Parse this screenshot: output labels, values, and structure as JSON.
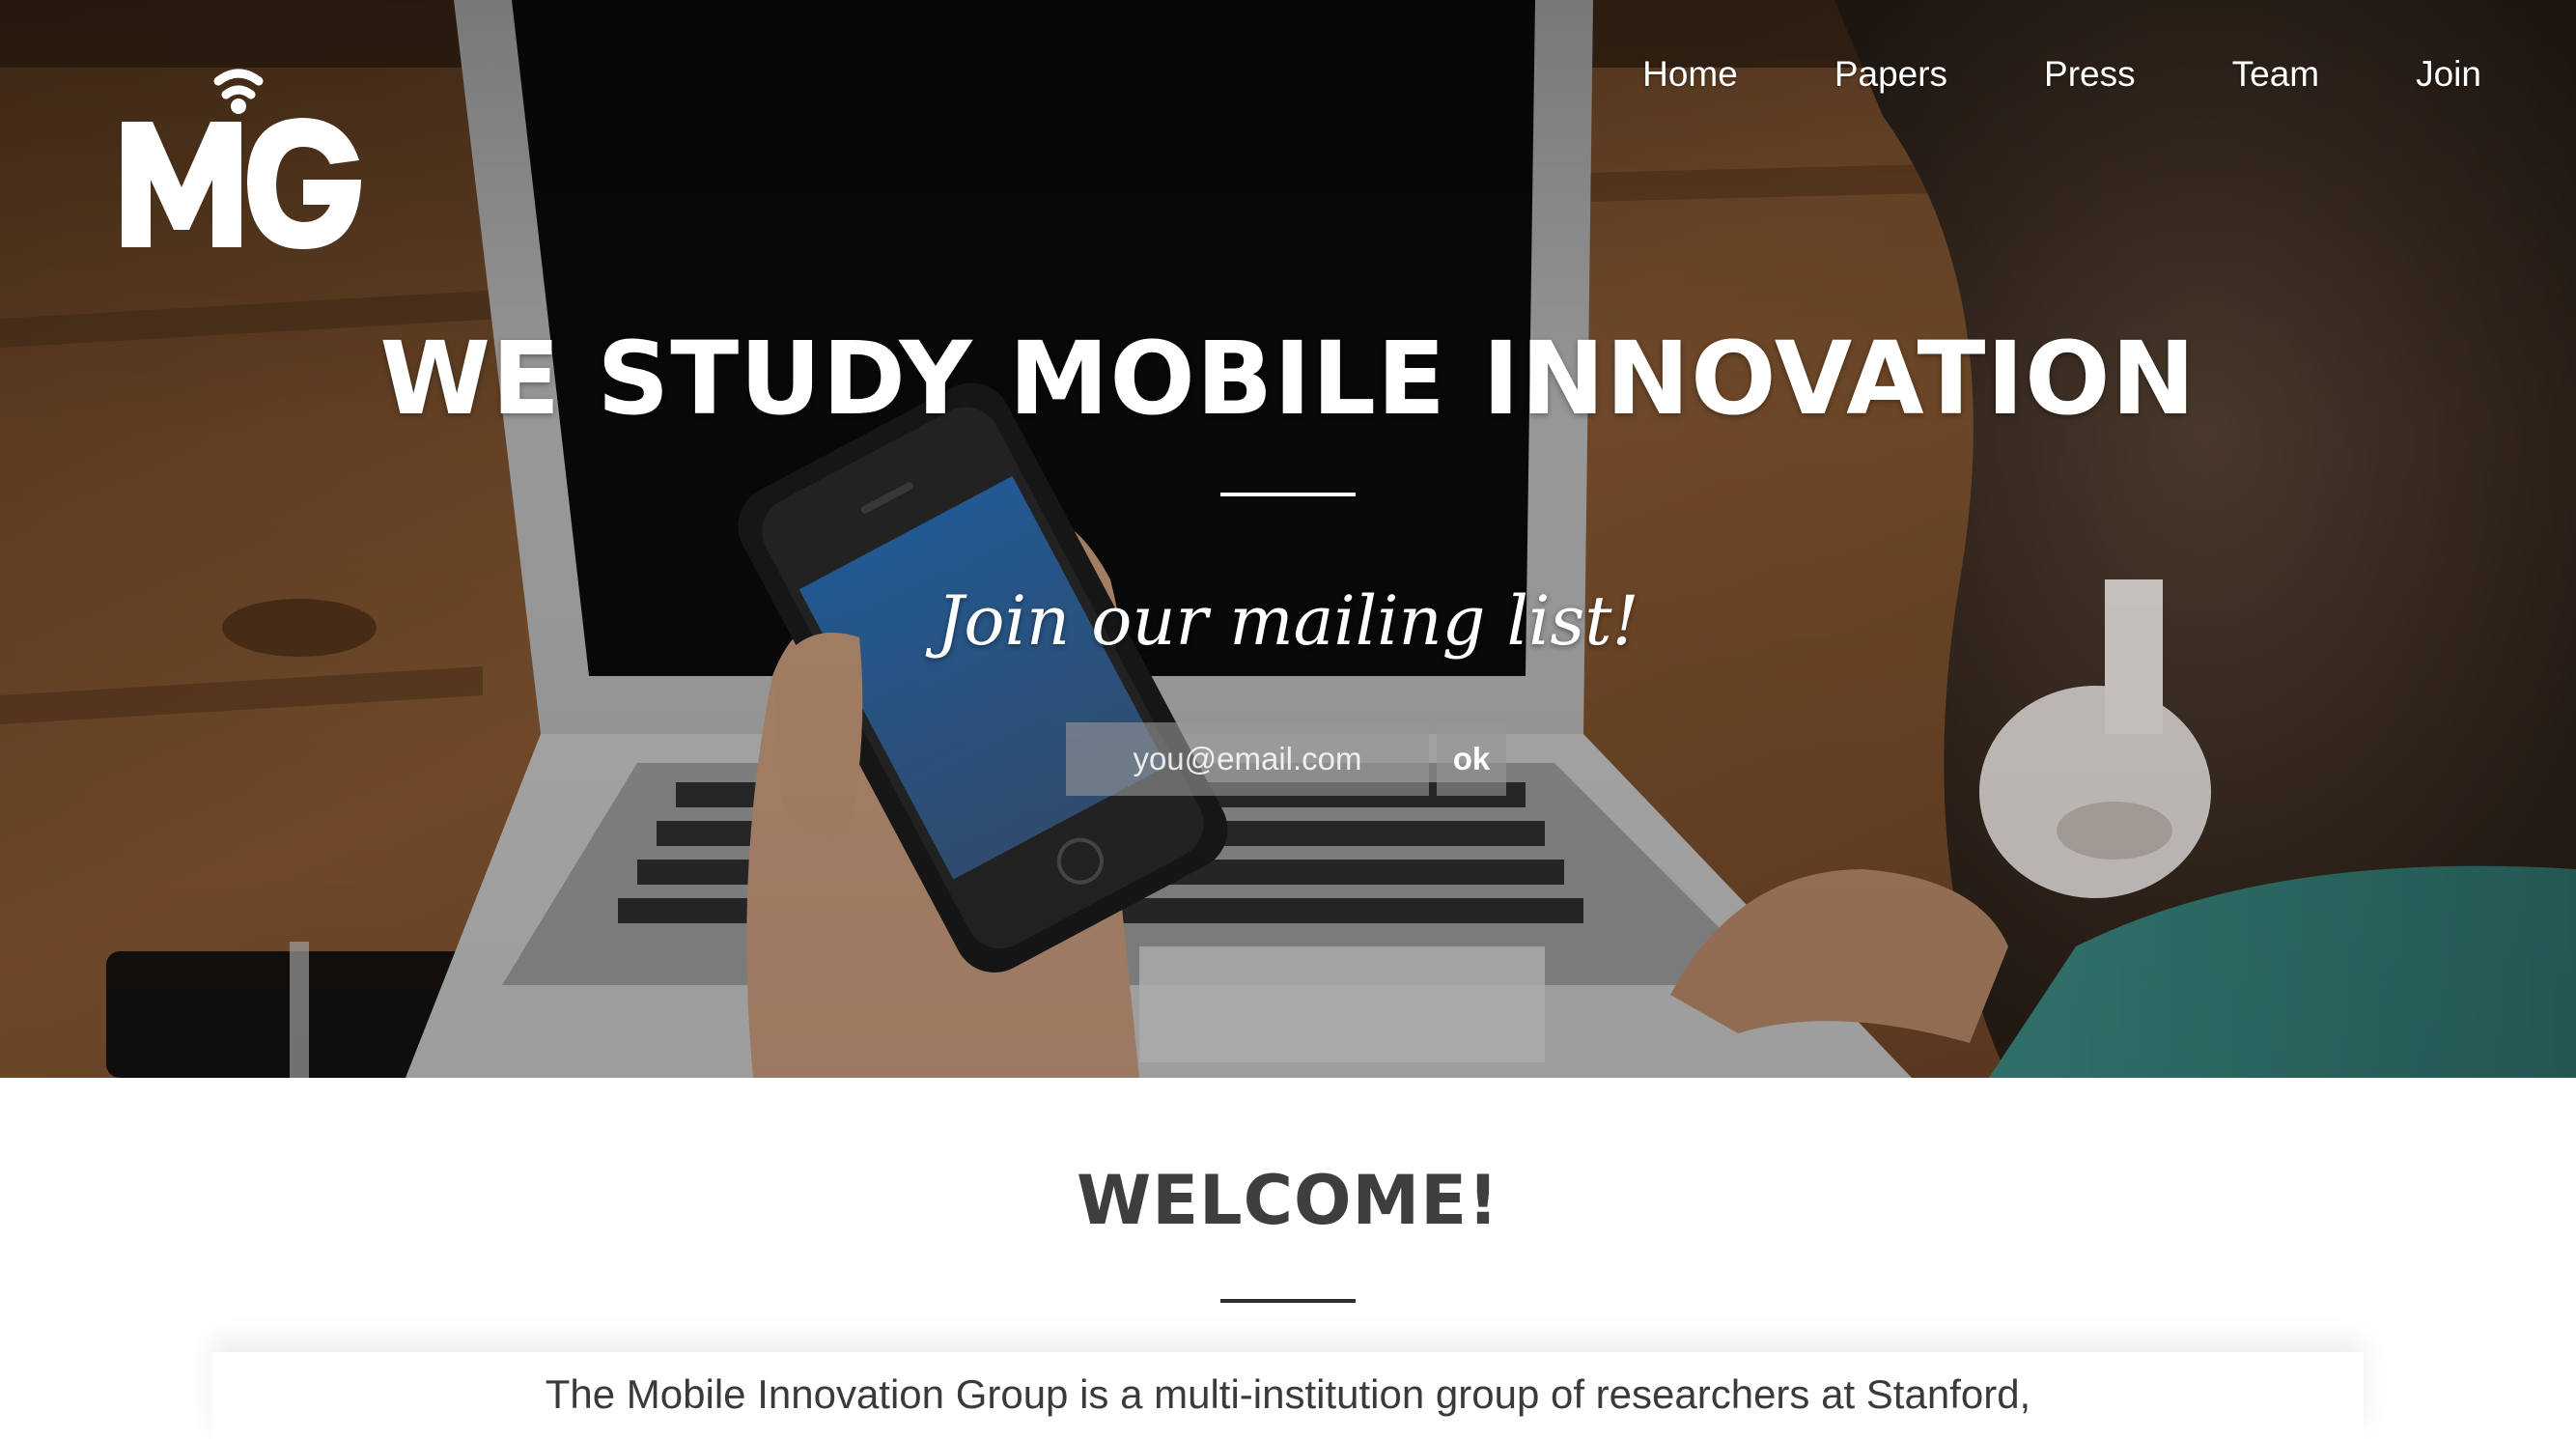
{
  "brand": {
    "logo_text": "MIG",
    "accent_color": "#ffffff"
  },
  "nav": {
    "items": [
      {
        "label": "Home"
      },
      {
        "label": "Papers"
      },
      {
        "label": "Press"
      },
      {
        "label": "Team"
      },
      {
        "label": "Join"
      }
    ]
  },
  "hero": {
    "headline": "WE STUDY MOBILE INNOVATION",
    "tagline": "Join our mailing list!",
    "email_placeholder": "you@email.com",
    "email_value": "",
    "submit_label": "ok"
  },
  "welcome": {
    "title": "WELCOME!",
    "intro": "The Mobile Innovation Group is a multi-institution group of researchers at Stanford,"
  }
}
